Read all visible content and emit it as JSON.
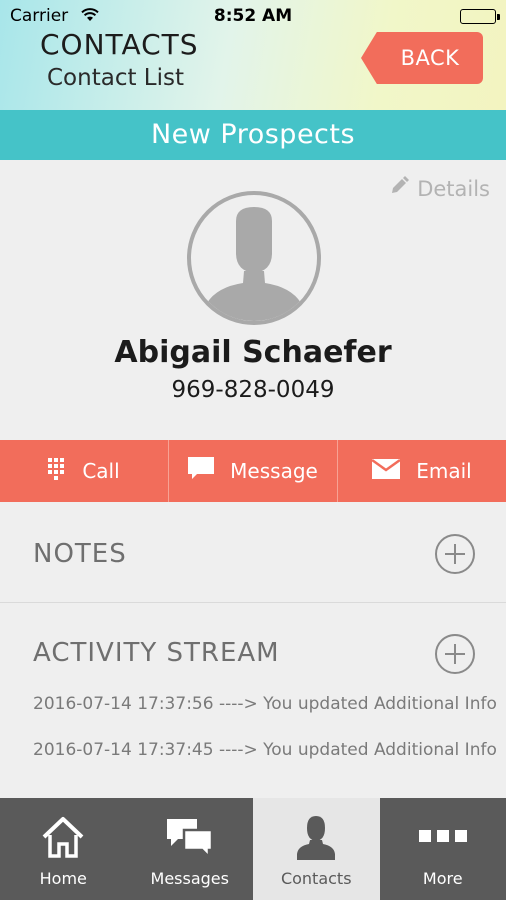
{
  "status_bar": {
    "carrier": "Carrier",
    "time": "8:52 AM"
  },
  "header": {
    "title": "CONTACTS",
    "subtitle": "Contact List",
    "back_label": "BACK"
  },
  "section": {
    "title": "New Prospects"
  },
  "contact": {
    "details_label": "Details",
    "name": "Abigail Schaefer",
    "phone": "969-828-0049"
  },
  "actions": [
    {
      "label": "Call",
      "icon": "keypad-icon"
    },
    {
      "label": "Message",
      "icon": "message-icon"
    },
    {
      "label": "Email",
      "icon": "envelope-icon"
    }
  ],
  "notes": {
    "label": "NOTES"
  },
  "activity": {
    "label": "ACTIVITY STREAM",
    "items": [
      "2016-07-14 17:37:56 ----> You updated Additional Info",
      "2016-07-14 17:37:45 ----> You updated Additional Info"
    ]
  },
  "tabs": [
    {
      "label": "Home",
      "icon": "home-icon"
    },
    {
      "label": "Messages",
      "icon": "chat-bubbles-icon"
    },
    {
      "label": "Contacts",
      "icon": "person-icon",
      "active": true
    },
    {
      "label": "More",
      "icon": "more-dots-icon"
    }
  ],
  "colors": {
    "accent": "#f26d5b",
    "teal": "#45c3c8",
    "tabbar": "#5a5a5a"
  }
}
